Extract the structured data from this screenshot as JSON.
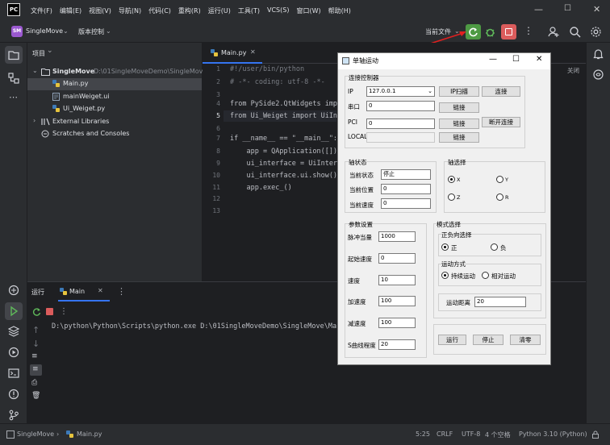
{
  "menubar": {
    "logo": "PC",
    "items": [
      "文件(F)",
      "编辑(E)",
      "视图(V)",
      "导航(N)",
      "代码(C)",
      "重构(R)",
      "运行(U)",
      "工具(T)",
      "VCS(S)",
      "窗口(W)",
      "帮助(H)"
    ]
  },
  "toolbar": {
    "project_badge": "SM",
    "project_name": "SingleMove",
    "vcs_label": "版本控制",
    "run_config": "当前文件"
  },
  "project_panel": {
    "title": "项目",
    "root_name": "SingleMove",
    "root_path": "D:\\01SingleMoveDemo\\SingleMove",
    "files": [
      "Main.py",
      "mainWeiget.ui",
      "Ui_Weiget.py"
    ],
    "external": "External Libraries",
    "scratches": "Scratches and Consoles"
  },
  "editor": {
    "tab": "Main.py",
    "close_label": "关闭",
    "line_numbers": [
      "1",
      "2",
      "3",
      "4",
      "5",
      "6",
      "7",
      "8",
      "9",
      "10",
      "11",
      "12",
      "13"
    ],
    "lines": [
      "#!/user/bin/python",
      "# -*- coding: utf-8 -*-",
      "",
      "from PySide2.QtWidgets imp",
      "from Ui_Weiget import UiIn",
      "",
      "if __name__ == \"__main__\":",
      "    app = QApplication([])",
      "    ui_interface = UiInter",
      "    ui_interface.ui.show()",
      "    app.exec_()",
      "",
      ""
    ]
  },
  "run_panel": {
    "label": "运行",
    "tab": "Main",
    "command": "D:\\python\\Python\\Scripts\\python.exe D:\\01SingleMoveDemo\\SingleMove\\Ma"
  },
  "statusbar": {
    "project": "SingleMove",
    "file": "Main.py",
    "position": "5:25",
    "line_sep": "CRLF",
    "encoding": "UTF-8",
    "indent": "4 个空格",
    "interpreter": "Python 3.10 (Python)"
  },
  "dialog": {
    "title": "单轴运动",
    "conn_group": "连接控制器",
    "ip_label": "IP",
    "ip_value": "127.0.0.1",
    "ip_scan": "IP扫描",
    "connect": "连接",
    "serial_label": "串口",
    "serial_value": "0",
    "link1": "链接",
    "pci_label": "PCI",
    "pci_value": "0",
    "link2": "链接",
    "disconnect": "断开连接",
    "local_label": "LOCAL",
    "link3": "链接",
    "axis_state_group": "轴状态",
    "cur_state_label": "当前状态",
    "cur_state_value": "停止",
    "cur_pos_label": "当前位置",
    "cur_pos_value": "0",
    "cur_speed_label": "当前速度",
    "cur_speed_value": "0",
    "axis_select_group": "轴选择",
    "axes": [
      "X",
      "Y",
      "Z",
      "R"
    ],
    "selected_axis": "X",
    "param_group": "参数设置",
    "params": [
      {
        "label": "脉冲当量",
        "value": "1000"
      },
      {
        "label": "起始速度",
        "value": "0"
      },
      {
        "label": "速度",
        "value": "10"
      },
      {
        "label": "加速度",
        "value": "100"
      },
      {
        "label": "减速度",
        "value": "100"
      },
      {
        "label": "S曲线程度",
        "value": "20"
      }
    ],
    "mode_group": "模式选择",
    "dir_group": "正负向选择",
    "dir_pos": "正",
    "dir_neg": "负",
    "motion_group": "运动方式",
    "motion_cont": "持续运动",
    "motion_rel": "相对运动",
    "distance_label": "运动距离",
    "distance_value": "20",
    "run_btn": "运行",
    "stop_btn": "停止",
    "clear_btn": "清零"
  }
}
